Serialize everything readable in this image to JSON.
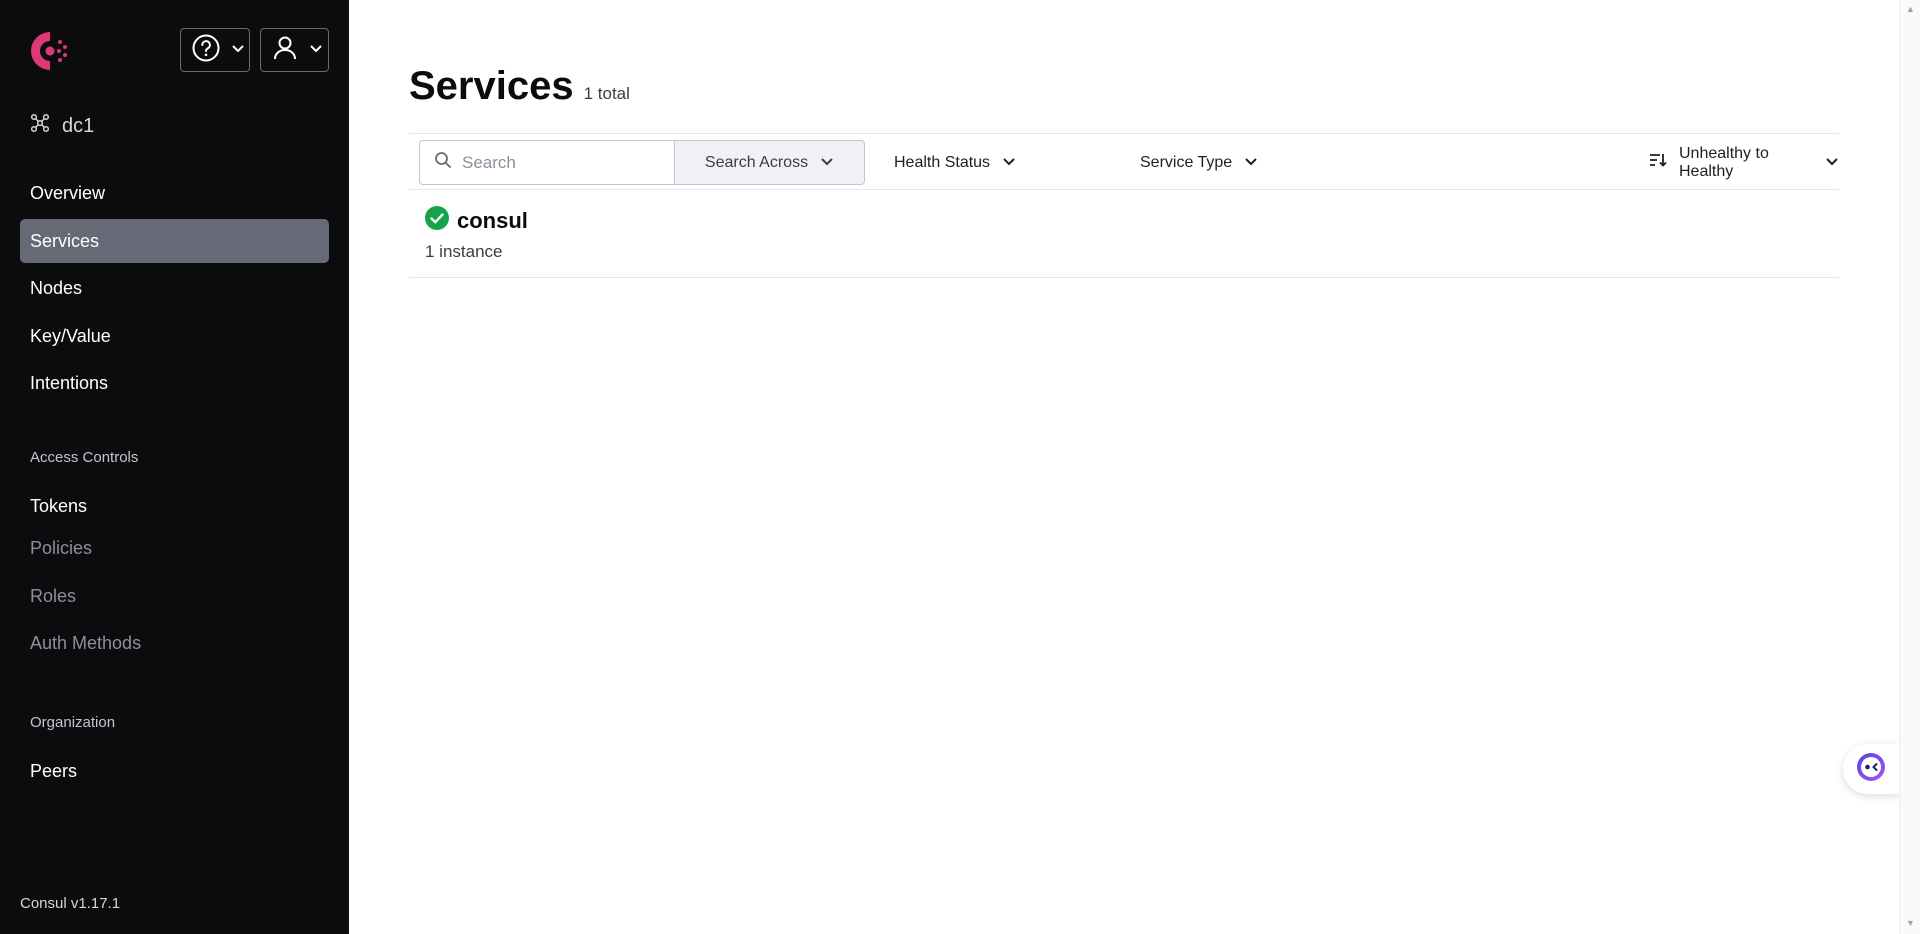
{
  "sidebar": {
    "datacenter": "dc1",
    "nav_main": [
      {
        "label": "Overview",
        "active": false
      },
      {
        "label": "Services",
        "active": true
      },
      {
        "label": "Nodes",
        "active": false
      },
      {
        "label": "Key/Value",
        "active": false
      },
      {
        "label": "Intentions",
        "active": false
      }
    ],
    "access_controls": {
      "heading": "Access Controls",
      "items": [
        {
          "label": "Tokens",
          "dim": false
        },
        {
          "label": "Policies",
          "dim": true
        },
        {
          "label": "Roles",
          "dim": true
        },
        {
          "label": "Auth Methods",
          "dim": true
        }
      ]
    },
    "organization": {
      "heading": "Organization",
      "items": [
        {
          "label": "Peers"
        }
      ]
    },
    "version": "Consul v1.17.1"
  },
  "header": {
    "help_icon": "question-circle-icon",
    "user_icon": "user-icon"
  },
  "main": {
    "title": "Services",
    "total": "1 total",
    "toolbar": {
      "search_placeholder": "Search",
      "search_across": "Search Across",
      "health_status": "Health Status",
      "service_type": "Service Type",
      "sort": "Unhealthy to Healthy"
    },
    "services": [
      {
        "name": "consul",
        "instances": "1 instance",
        "status": "passing"
      }
    ]
  },
  "colors": {
    "sidebar_bg": "#0c0c0e",
    "active_nav": "#656a76",
    "brand": "#e03875",
    "healthy": "#16a34a"
  }
}
